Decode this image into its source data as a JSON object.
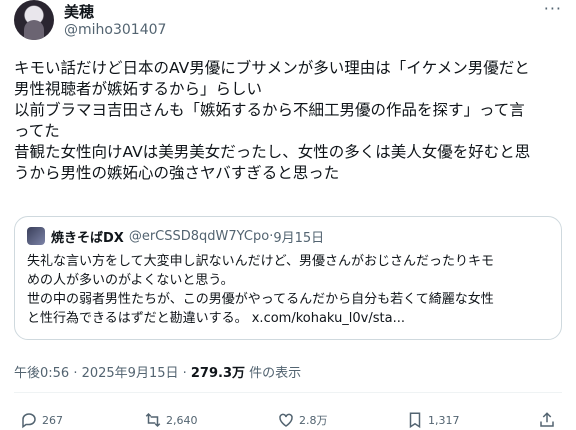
{
  "user": {
    "name": "美穂",
    "handle": "@miho301407",
    "more": "···"
  },
  "post": {
    "lines": [
      "キモい話だけど日本のAV男優にブサメンが多い理由は「イケメン男優だと",
      "男性視聴者が嫉妬するから」らしい",
      "以前ブラマヨ吉田さんも「嫉妬するから不細工男優の作品を探す」って言",
      "ってた",
      "昔観た女性向けAVは美男美女だったし、女性の多くは美人女優を好むと思",
      "うから男性の嫉妬心の強さヤバすぎると思った"
    ]
  },
  "quote": {
    "name": "焼きそばDX",
    "handle": "@erCSSD8qdW7YCpo",
    "separator": " · ",
    "date": "9月15日",
    "lines": [
      "失礼な言い方をして大変申し訳ないんだけど、男優さんがおじさんだったりキモ",
      "めの人が多いのがよくないと思う。",
      "世の中の弱者男性たちが、この男優がやってるんだから自分も若くて綺麗な女性",
      "と性行為できるはずだと勘違いする。 x.com/kohaku_l0v/sta..."
    ]
  },
  "meta": {
    "time": "午後0:56 · 2025年9月15日 · ",
    "views": "279.3万",
    "views_suffix": " 件の表示"
  },
  "actions": {
    "replies": "267",
    "reposts": "2,640",
    "likes": "2.8万",
    "bookmarks": "1,317"
  },
  "colors": {
    "text": "#0f1419",
    "secondary": "#536471",
    "border": "#cfd9de"
  },
  "icons": [
    "reply-icon",
    "repost-icon",
    "like-icon",
    "bookmark-icon",
    "share-icon"
  ]
}
